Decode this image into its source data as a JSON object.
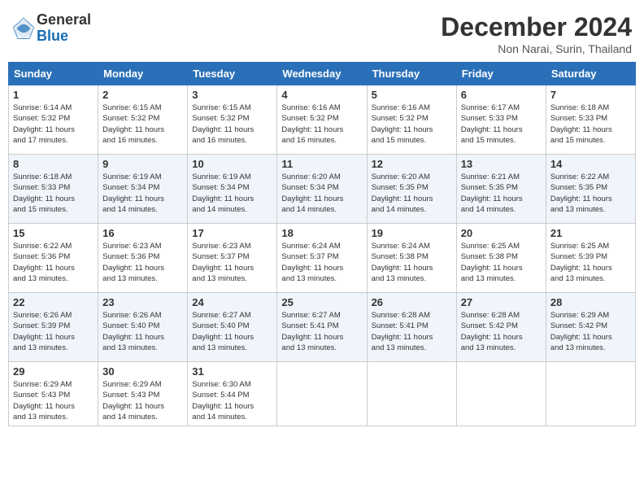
{
  "header": {
    "logo_general": "General",
    "logo_blue": "Blue",
    "month_year": "December 2024",
    "location": "Non Narai, Surin, Thailand"
  },
  "days_of_week": [
    "Sunday",
    "Monday",
    "Tuesday",
    "Wednesday",
    "Thursday",
    "Friday",
    "Saturday"
  ],
  "weeks": [
    [
      {
        "day": "1",
        "sunrise": "6:14 AM",
        "sunset": "5:32 PM",
        "daylight": "11 hours and 17 minutes."
      },
      {
        "day": "2",
        "sunrise": "6:15 AM",
        "sunset": "5:32 PM",
        "daylight": "11 hours and 16 minutes."
      },
      {
        "day": "3",
        "sunrise": "6:15 AM",
        "sunset": "5:32 PM",
        "daylight": "11 hours and 16 minutes."
      },
      {
        "day": "4",
        "sunrise": "6:16 AM",
        "sunset": "5:32 PM",
        "daylight": "11 hours and 16 minutes."
      },
      {
        "day": "5",
        "sunrise": "6:16 AM",
        "sunset": "5:32 PM",
        "daylight": "11 hours and 15 minutes."
      },
      {
        "day": "6",
        "sunrise": "6:17 AM",
        "sunset": "5:33 PM",
        "daylight": "11 hours and 15 minutes."
      },
      {
        "day": "7",
        "sunrise": "6:18 AM",
        "sunset": "5:33 PM",
        "daylight": "11 hours and 15 minutes."
      }
    ],
    [
      {
        "day": "8",
        "sunrise": "6:18 AM",
        "sunset": "5:33 PM",
        "daylight": "11 hours and 15 minutes."
      },
      {
        "day": "9",
        "sunrise": "6:19 AM",
        "sunset": "5:34 PM",
        "daylight": "11 hours and 14 minutes."
      },
      {
        "day": "10",
        "sunrise": "6:19 AM",
        "sunset": "5:34 PM",
        "daylight": "11 hours and 14 minutes."
      },
      {
        "day": "11",
        "sunrise": "6:20 AM",
        "sunset": "5:34 PM",
        "daylight": "11 hours and 14 minutes."
      },
      {
        "day": "12",
        "sunrise": "6:20 AM",
        "sunset": "5:35 PM",
        "daylight": "11 hours and 14 minutes."
      },
      {
        "day": "13",
        "sunrise": "6:21 AM",
        "sunset": "5:35 PM",
        "daylight": "11 hours and 14 minutes."
      },
      {
        "day": "14",
        "sunrise": "6:22 AM",
        "sunset": "5:35 PM",
        "daylight": "11 hours and 13 minutes."
      }
    ],
    [
      {
        "day": "15",
        "sunrise": "6:22 AM",
        "sunset": "5:36 PM",
        "daylight": "11 hours and 13 minutes."
      },
      {
        "day": "16",
        "sunrise": "6:23 AM",
        "sunset": "5:36 PM",
        "daylight": "11 hours and 13 minutes."
      },
      {
        "day": "17",
        "sunrise": "6:23 AM",
        "sunset": "5:37 PM",
        "daylight": "11 hours and 13 minutes."
      },
      {
        "day": "18",
        "sunrise": "6:24 AM",
        "sunset": "5:37 PM",
        "daylight": "11 hours and 13 minutes."
      },
      {
        "day": "19",
        "sunrise": "6:24 AM",
        "sunset": "5:38 PM",
        "daylight": "11 hours and 13 minutes."
      },
      {
        "day": "20",
        "sunrise": "6:25 AM",
        "sunset": "5:38 PM",
        "daylight": "11 hours and 13 minutes."
      },
      {
        "day": "21",
        "sunrise": "6:25 AM",
        "sunset": "5:39 PM",
        "daylight": "11 hours and 13 minutes."
      }
    ],
    [
      {
        "day": "22",
        "sunrise": "6:26 AM",
        "sunset": "5:39 PM",
        "daylight": "11 hours and 13 minutes."
      },
      {
        "day": "23",
        "sunrise": "6:26 AM",
        "sunset": "5:40 PM",
        "daylight": "11 hours and 13 minutes."
      },
      {
        "day": "24",
        "sunrise": "6:27 AM",
        "sunset": "5:40 PM",
        "daylight": "11 hours and 13 minutes."
      },
      {
        "day": "25",
        "sunrise": "6:27 AM",
        "sunset": "5:41 PM",
        "daylight": "11 hours and 13 minutes."
      },
      {
        "day": "26",
        "sunrise": "6:28 AM",
        "sunset": "5:41 PM",
        "daylight": "11 hours and 13 minutes."
      },
      {
        "day": "27",
        "sunrise": "6:28 AM",
        "sunset": "5:42 PM",
        "daylight": "11 hours and 13 minutes."
      },
      {
        "day": "28",
        "sunrise": "6:29 AM",
        "sunset": "5:42 PM",
        "daylight": "11 hours and 13 minutes."
      }
    ],
    [
      {
        "day": "29",
        "sunrise": "6:29 AM",
        "sunset": "5:43 PM",
        "daylight": "11 hours and 13 minutes."
      },
      {
        "day": "30",
        "sunrise": "6:29 AM",
        "sunset": "5:43 PM",
        "daylight": "11 hours and 14 minutes."
      },
      {
        "day": "31",
        "sunrise": "6:30 AM",
        "sunset": "5:44 PM",
        "daylight": "11 hours and 14 minutes."
      },
      null,
      null,
      null,
      null
    ]
  ]
}
